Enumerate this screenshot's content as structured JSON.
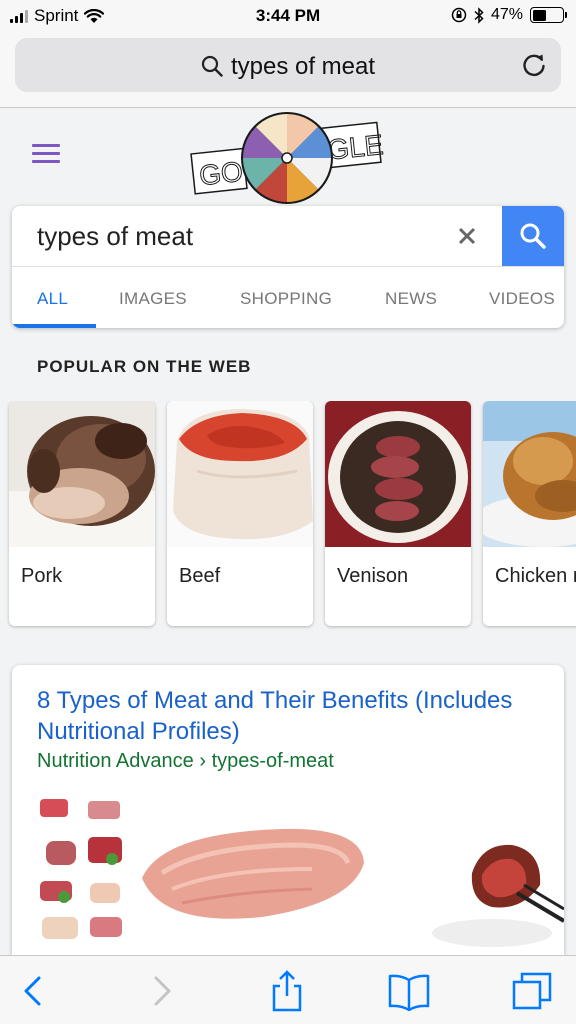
{
  "status_bar": {
    "carrier": "Sprint",
    "time": "3:44 PM",
    "battery": "47%",
    "battery_level": 0.47,
    "icons": [
      "signal-icon",
      "wifi-icon",
      "orientation-lock-icon",
      "bluetooth-icon",
      "battery-icon"
    ]
  },
  "browser": {
    "address_text": "types of meat",
    "icons": [
      "search-icon",
      "reload-icon"
    ]
  },
  "google": {
    "doodle_letters_left": "GO",
    "doodle_letters_right": "GLE",
    "menu_icon": "hamburger-menu-icon"
  },
  "search": {
    "query": "types of meat",
    "clear_icon": "close-icon",
    "tabs": [
      {
        "label": "ALL",
        "active": true
      },
      {
        "label": "IMAGES",
        "active": false
      },
      {
        "label": "SHOPPING",
        "active": false
      },
      {
        "label": "NEWS",
        "active": false
      },
      {
        "label": "VIDEOS",
        "active": false
      }
    ]
  },
  "popular": {
    "title": "POPULAR ON THE WEB",
    "items": [
      {
        "label": "Pork"
      },
      {
        "label": "Beef"
      },
      {
        "label": "Venison"
      },
      {
        "label": "Chicken meat"
      }
    ]
  },
  "result": {
    "title": "8 Types of Meat and Their Benefits (Includes Nutritional Profiles)",
    "site": "Nutrition Advance",
    "separator": "›",
    "path": "types-of-meat"
  },
  "toolbar": {
    "icons": [
      "back-icon",
      "forward-icon",
      "share-icon",
      "bookmarks-icon",
      "tabs-icon"
    ]
  },
  "colors": {
    "accent_blue": "#1a73e8",
    "search_button": "#4285f4",
    "url_green": "#137333",
    "menu_purple": "#7e57c2",
    "ios_blue": "#007aff"
  }
}
